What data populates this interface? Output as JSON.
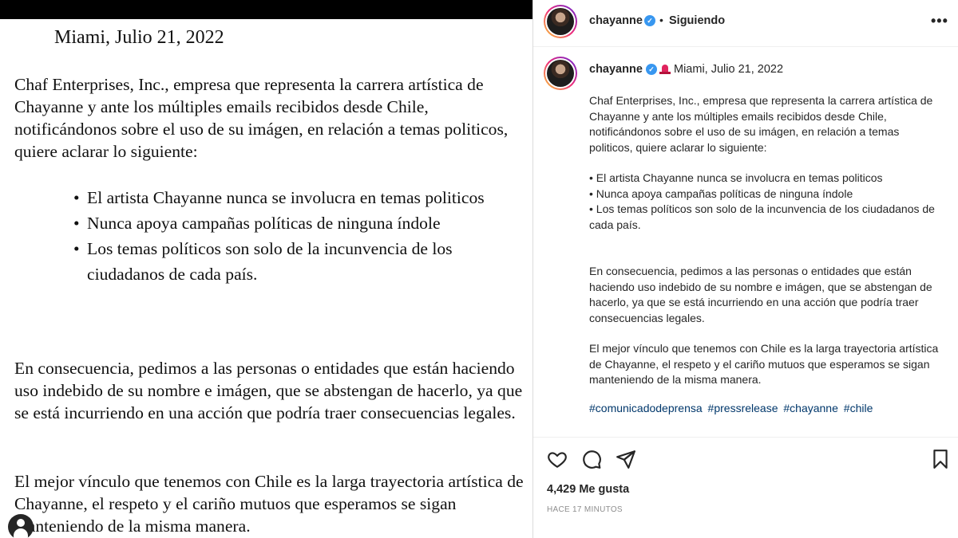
{
  "letter": {
    "date": "Miami, Julio 21, 2022",
    "paragraph1": "Chaf Enterprises, Inc., empresa que representa la carrera artística de Chayanne y ante los múltiples emails recibidos desde Chile, notificándonos sobre el uso de su imágen, en relación a temas politicos, quiere aclarar lo siguiente:",
    "bullets": [
      "El artista Chayanne nunca se involucra en temas politicos",
      "Nunca apoya campañas políticas de ninguna índole",
      "Los temas políticos son solo de la incunvencia de los ciudadanos de cada país."
    ],
    "paragraph2": "En consecuencia, pedimos a las personas o entidades que están haciendo uso indebido de su nombre e imágen, que se abstengan de hacerlo, ya que se está incurriendo en una acción que podría traer consecuencias legales.",
    "paragraph3": "El mejor vínculo que tenemos con Chile es la larga trayectoria artística de Chayanne, el respeto y el cariño mutuos que esperamos se sigan manteniendo de la misma manera."
  },
  "header": {
    "username": "chayanne",
    "separator": "•",
    "follow_status": "Siguiendo",
    "more_icon": "more-horizontal-icon",
    "more_label": "•••"
  },
  "caption": {
    "username": "chayanne",
    "date": "Miami, Julio 21, 2022",
    "paragraph1": "Chaf Enterprises, Inc., empresa que representa la carrera artística de Chayanne y ante los múltiples emails recibidos desde Chile, notificándonos sobre el uso de su imágen, en relación a temas politicos, quiere aclarar lo siguiente:",
    "bullets": [
      "• El artista Chayanne nunca se involucra en temas politicos",
      "• Nunca apoya campañas políticas de ninguna índole",
      "• Los temas políticos son solo de la incunvencia de los ciudadanos de cada país."
    ],
    "paragraph2": "En consecuencia, pedimos a las personas o entidades que están haciendo uso indebido de su nombre e imágen, que se abstengan de hacerlo, ya que se está incurriendo en una acción que podría traer consecuencias legales.",
    "paragraph3": "El mejor vínculo que tenemos con Chile es la larga trayectoria artística de Chayanne, el respeto y el cariño mutuos que esperamos se sigan manteniendo de la misma manera.",
    "hashtags": [
      "#comunicadodeprensa",
      "#pressrelease",
      "#chayanne",
      "#chile"
    ]
  },
  "actions": {
    "icons": [
      "heart-icon",
      "comment-icon",
      "share-icon",
      "bookmark-icon"
    ],
    "likes": "4,429 Me gusta",
    "timestamp": "HACE 17 MINUTOS"
  },
  "colors": {
    "verified": "#3897f0",
    "hashtag": "#00376b",
    "text": "#262626",
    "muted": "#8e8e8e"
  }
}
